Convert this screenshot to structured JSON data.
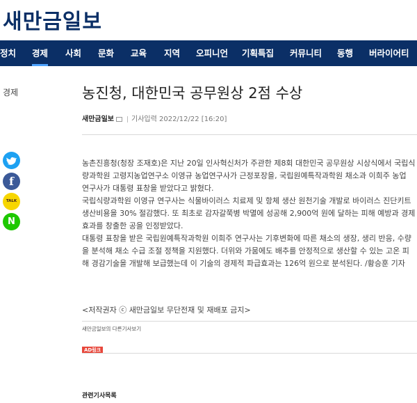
{
  "site": {
    "name": "새만금일보"
  },
  "nav": {
    "items": [
      "정치",
      "경제",
      "사회",
      "문화",
      "교육",
      "지역",
      "오피니언",
      "기획특집",
      "커뮤니티",
      "동행",
      "버라이어티"
    ],
    "active": "경제"
  },
  "sidebar": {
    "category": "경제"
  },
  "social": [
    {
      "name": "twitter",
      "color": "#1da1f2",
      "icon": "twitter-bird-icon"
    },
    {
      "name": "facebook",
      "color": "#3b5998",
      "icon": "facebook-f-icon",
      "glyph": "f"
    },
    {
      "name": "kakaotalk",
      "color": "#f7d600",
      "icon": "kakao-talk-icon",
      "glyph": "TALK"
    },
    {
      "name": "naver",
      "color": "#1ec800",
      "icon": "naver-n-icon",
      "glyph": "N"
    }
  ],
  "article": {
    "title": "농진청, 대한민국 공무원상 2점 수상",
    "author": "새만금일보",
    "date_label": "기사입력 2022/12/22 [16:20]",
    "body_lines": [
      "농촌진흥청(청장 조재호)은 지난 20일 인사혁신처가 주관한 제8회 대한민국 공무원상 시상식에서 국립식",
      "량과학원 고령지농업연구소 이영규 농업연구사가 근정포장을, 국립원예특작과학원 채소과 이희주 농업",
      "연구사가 대통령 표창을 받았다고 밝혔다.",
      "국립식량과학원 이영규 연구사는 식물바이러스 치료제 및 항체 생산 원천기술 개발로 바이러스 진단키트",
      "생산비용을 30% 절감했다. 또 최초로 감자갈쭉병 박멸에 성공해 2,900억 원에 달하는 피해 예방과 경제",
      "효과를 창출한 공을 인정받았다.",
      "대통령 표창을 받은 국립원예특작과학원 이희주 연구사는 기후변화에 따른 채소의 생장, 생리 반응, 수량",
      "을 분석해 채소 수급 조절 정책을 지원했다. 더위와 가뭄에도 배추를 안정적으로 생산할 수 있는 고온 피",
      "해 경감기술을 개발해 보급했는데 이 기술의 경제적 파급효과는 126억 원으로 분석된다. /황승훈 기자"
    ],
    "copyright": "<저작권자 ⓒ 새만금일보 무단전재 및 재배포 금지>",
    "more_link": "새만금일보의 다른기사보기"
  },
  "ad": {
    "badge": "AD링크"
  },
  "related": {
    "heading": "관련기사목록"
  }
}
